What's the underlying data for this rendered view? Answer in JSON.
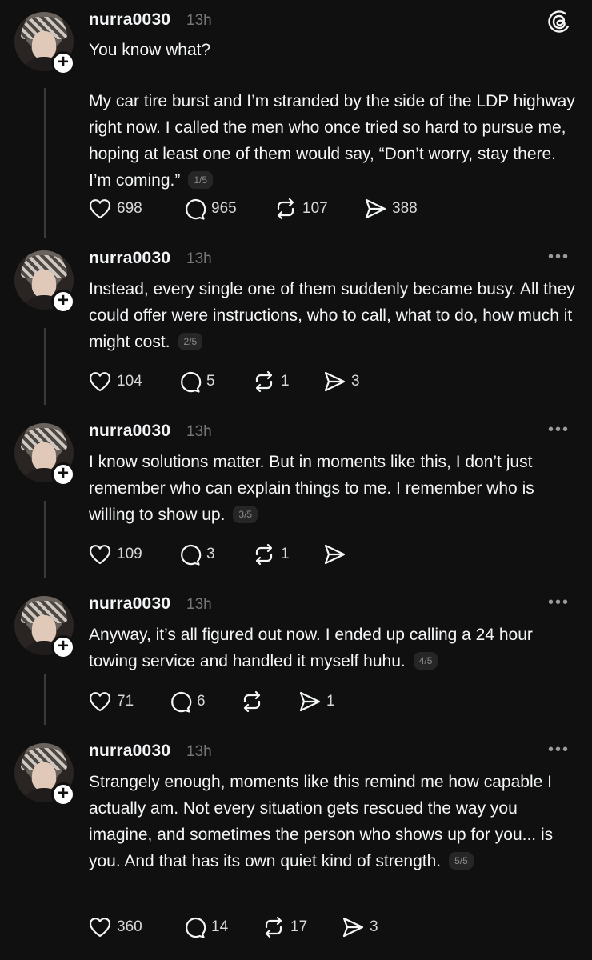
{
  "posts": [
    {
      "username": "nurra0030",
      "time": "13h",
      "paragraphs": [
        "You know what?",
        "My car tire burst and I’m stranded by the side of the LDP highway right now. I called the men who once tried so hard to pursue me, hoping at least one of them would say, “Don’t worry, stay there. I’m coming.”"
      ],
      "page": "1/5",
      "likes": "698",
      "replies": "965",
      "reposts": "107",
      "shares": "388"
    },
    {
      "username": "nurra0030",
      "time": "13h",
      "paragraphs": [
        "Instead, every single one of them suddenly became busy. All they could offer were instructions, who to call, what to do, how much it might cost."
      ],
      "page": "2/5",
      "likes": "104",
      "replies": "5",
      "reposts": "1",
      "shares": "3"
    },
    {
      "username": "nurra0030",
      "time": "13h",
      "paragraphs": [
        "I know solutions matter. But in moments like this, I don’t just remember who can explain things to me. I remember who is willing to show up."
      ],
      "page": "3/5",
      "likes": "109",
      "replies": "3",
      "reposts": "1",
      "shares": ""
    },
    {
      "username": "nurra0030",
      "time": "13h",
      "paragraphs": [
        "Anyway, it’s all figured out now. I ended up calling a 24 hour towing service and handled it myself huhu."
      ],
      "page": "4/5",
      "likes": "71",
      "replies": "6",
      "reposts": "",
      "shares": "1"
    },
    {
      "username": "nurra0030",
      "time": "13h",
      "paragraphs": [
        "Strangely enough, moments like this remind me how capable I actually am. Not every situation gets rescued the way you imagine, and sometimes the person who shows up for you... is you. And that has its own quiet kind of strength."
      ],
      "page": "5/5",
      "likes": "360",
      "replies": "14",
      "reposts": "17",
      "shares": "3"
    }
  ],
  "icons": {
    "like": "heart-icon",
    "reply": "comment-icon",
    "repost": "repost-icon",
    "share": "send-icon",
    "more": "more-icon",
    "logo": "threads-logo-icon"
  },
  "more_glyph": "•••"
}
